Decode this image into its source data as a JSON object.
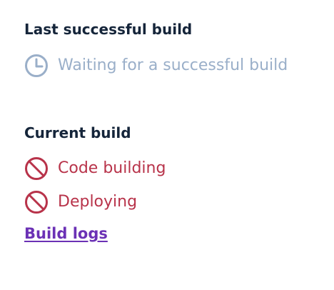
{
  "last_successful": {
    "title": "Last successful build",
    "status": {
      "icon": "clock-icon",
      "text": "Waiting for a successful build",
      "color": "#9aafc9"
    }
  },
  "current_build": {
    "title": "Current build",
    "items": [
      {
        "icon": "blocked-icon",
        "text": "Code building",
        "color": "#b8334a"
      },
      {
        "icon": "blocked-icon",
        "text": "Deploying",
        "color": "#b8334a"
      }
    ]
  },
  "links": {
    "build_logs": "Build logs",
    "color": "#6b31b5"
  }
}
